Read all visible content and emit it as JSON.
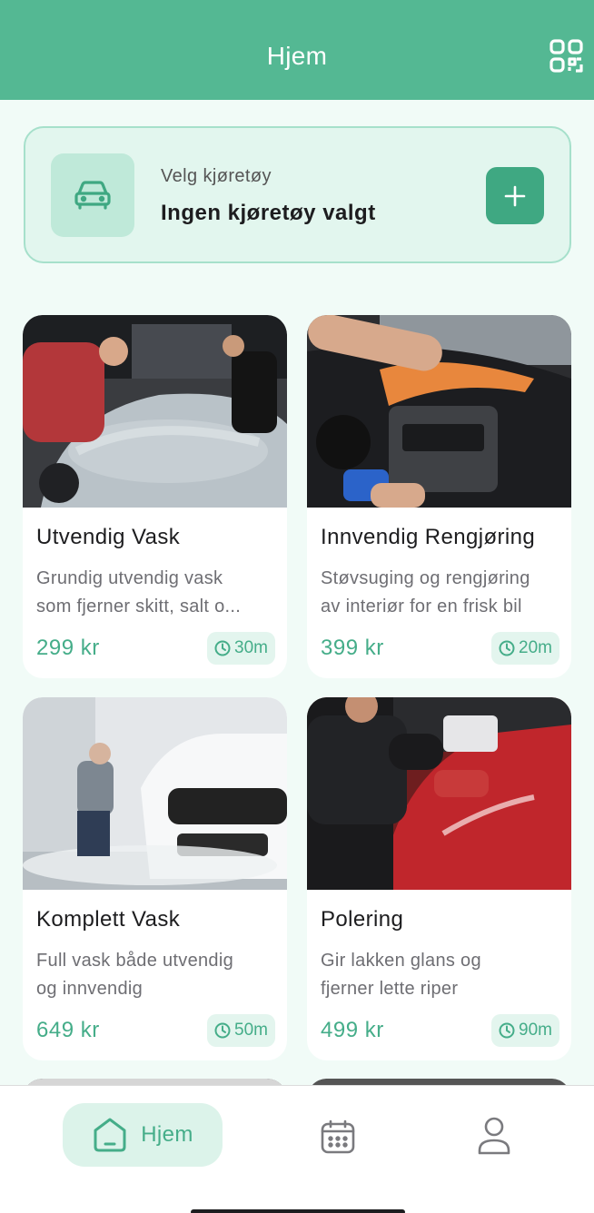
{
  "header": {
    "title": "Hjem",
    "qr_icon": "qr-code-icon"
  },
  "vehicle": {
    "label": "Velg kjøretøy",
    "value": "Ingen kjøretøy valgt",
    "car_icon": "car-icon",
    "add_icon": "plus-icon"
  },
  "services": [
    {
      "name": "Utvendig Vask",
      "desc_line1": "Grundig utvendig vask",
      "desc_line2": "som fjerner skitt, salt o...",
      "price": "299 kr",
      "duration": "30m"
    },
    {
      "name": "Innvendig Rengjøring",
      "desc_line1": "Støvsuging og rengjøring",
      "desc_line2": "av interiør for en frisk bil",
      "price": "399 kr",
      "duration": "20m"
    },
    {
      "name": "Komplett Vask",
      "desc_line1": "Full vask både utvendig",
      "desc_line2": "og innvendig",
      "price": "649 kr",
      "duration": "50m"
    },
    {
      "name": "Polering",
      "desc_line1": "Gir lakken glans og",
      "desc_line2": "fjerner lette riper",
      "price": "499 kr",
      "duration": "90m"
    }
  ],
  "nav": {
    "home_label": "Hjem",
    "home_icon": "home-icon",
    "calendar_icon": "calendar-icon",
    "profile_icon": "profile-icon"
  },
  "colors": {
    "primary": "#54b893",
    "accent": "#45ad89",
    "button": "#3fa882",
    "background": "#f1fbf7"
  }
}
